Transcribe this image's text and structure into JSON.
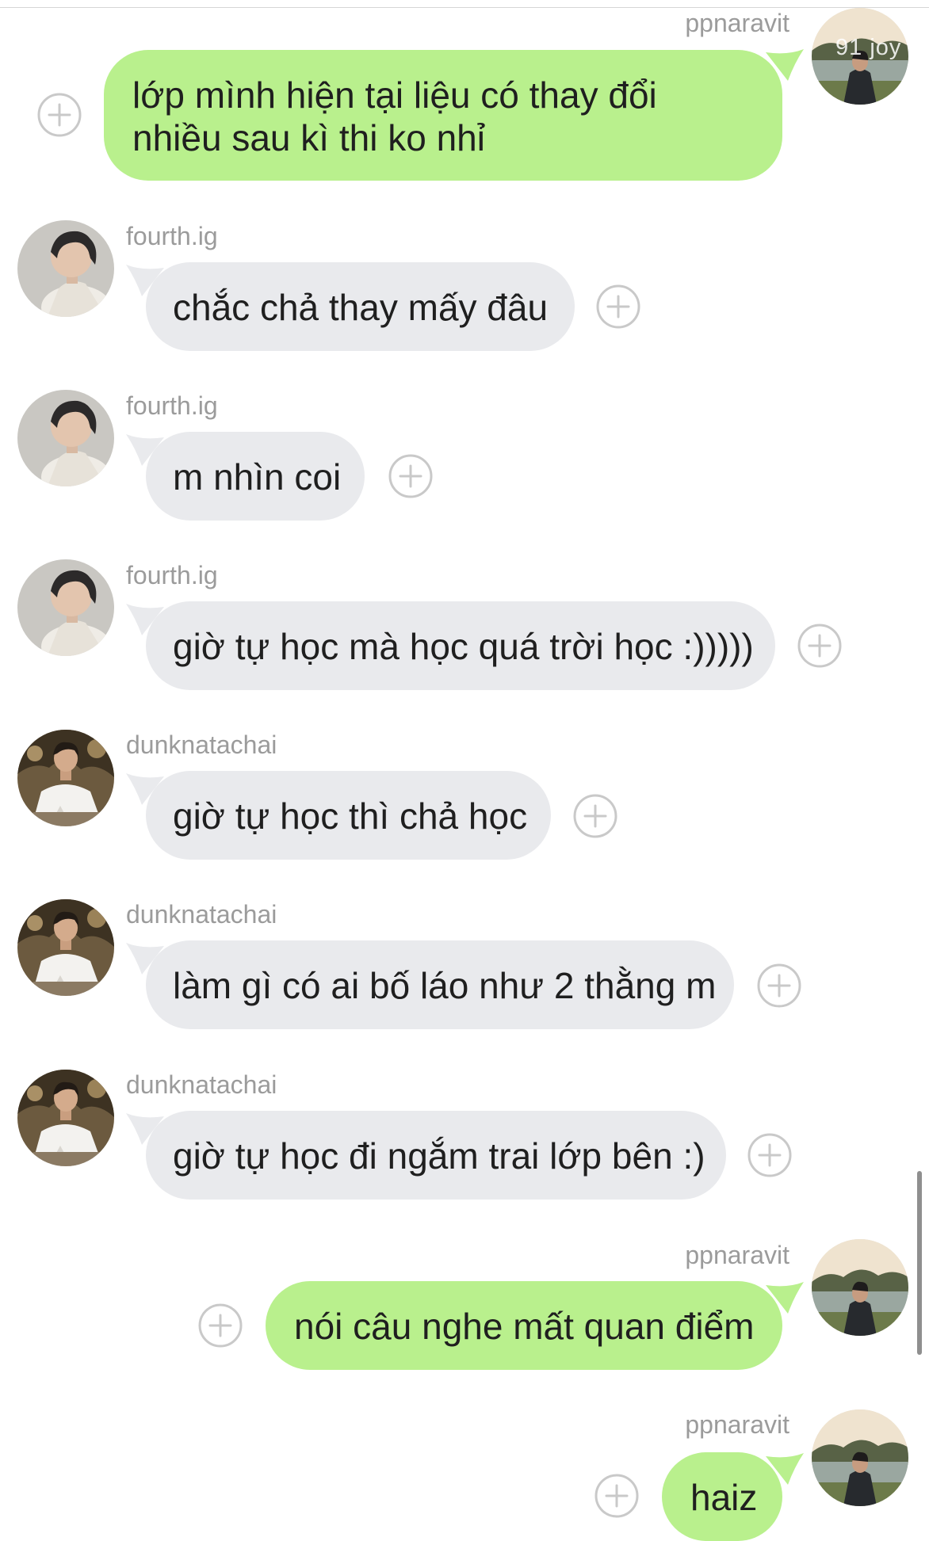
{
  "chat": {
    "messages": [
      {
        "sender": "ppnaravit",
        "text": "lớp mình hiện tại liệu có thay đổi nhiều sau kì thi ko nhỉ",
        "direction": "out",
        "avatar_overlay": "91 joy"
      },
      {
        "sender": "fourth.ig",
        "text": "chắc chả thay mấy đâu",
        "direction": "in"
      },
      {
        "sender": "fourth.ig",
        "text": "m nhìn coi",
        "direction": "in"
      },
      {
        "sender": "fourth.ig",
        "text": "giờ tự học mà học quá trời học :)))))",
        "direction": "in"
      },
      {
        "sender": "dunknatachai",
        "text": "giờ tự học thì chả học",
        "direction": "in"
      },
      {
        "sender": "dunknatachai",
        "text": "làm gì có ai bố láo như 2 thằng m",
        "direction": "in"
      },
      {
        "sender": "dunknatachai",
        "text": "giờ tự học đi ngắm trai lớp bên :)",
        "direction": "in"
      },
      {
        "sender": "ppnaravit",
        "text": "nói câu nghe mất quan điểm",
        "direction": "out"
      },
      {
        "sender": "ppnaravit",
        "text": "haiz",
        "direction": "out"
      }
    ]
  },
  "icons": {
    "add_reaction": "plus-circle-icon",
    "avatar": "avatar-photo"
  },
  "colors": {
    "incoming_bubble": "#e9eaed",
    "outgoing_bubble": "#b9f08d",
    "sender_text": "#9b9b9b",
    "message_text": "#1f1f1f",
    "plus_icon": "#c9c9c9",
    "background": "#ffffff"
  }
}
